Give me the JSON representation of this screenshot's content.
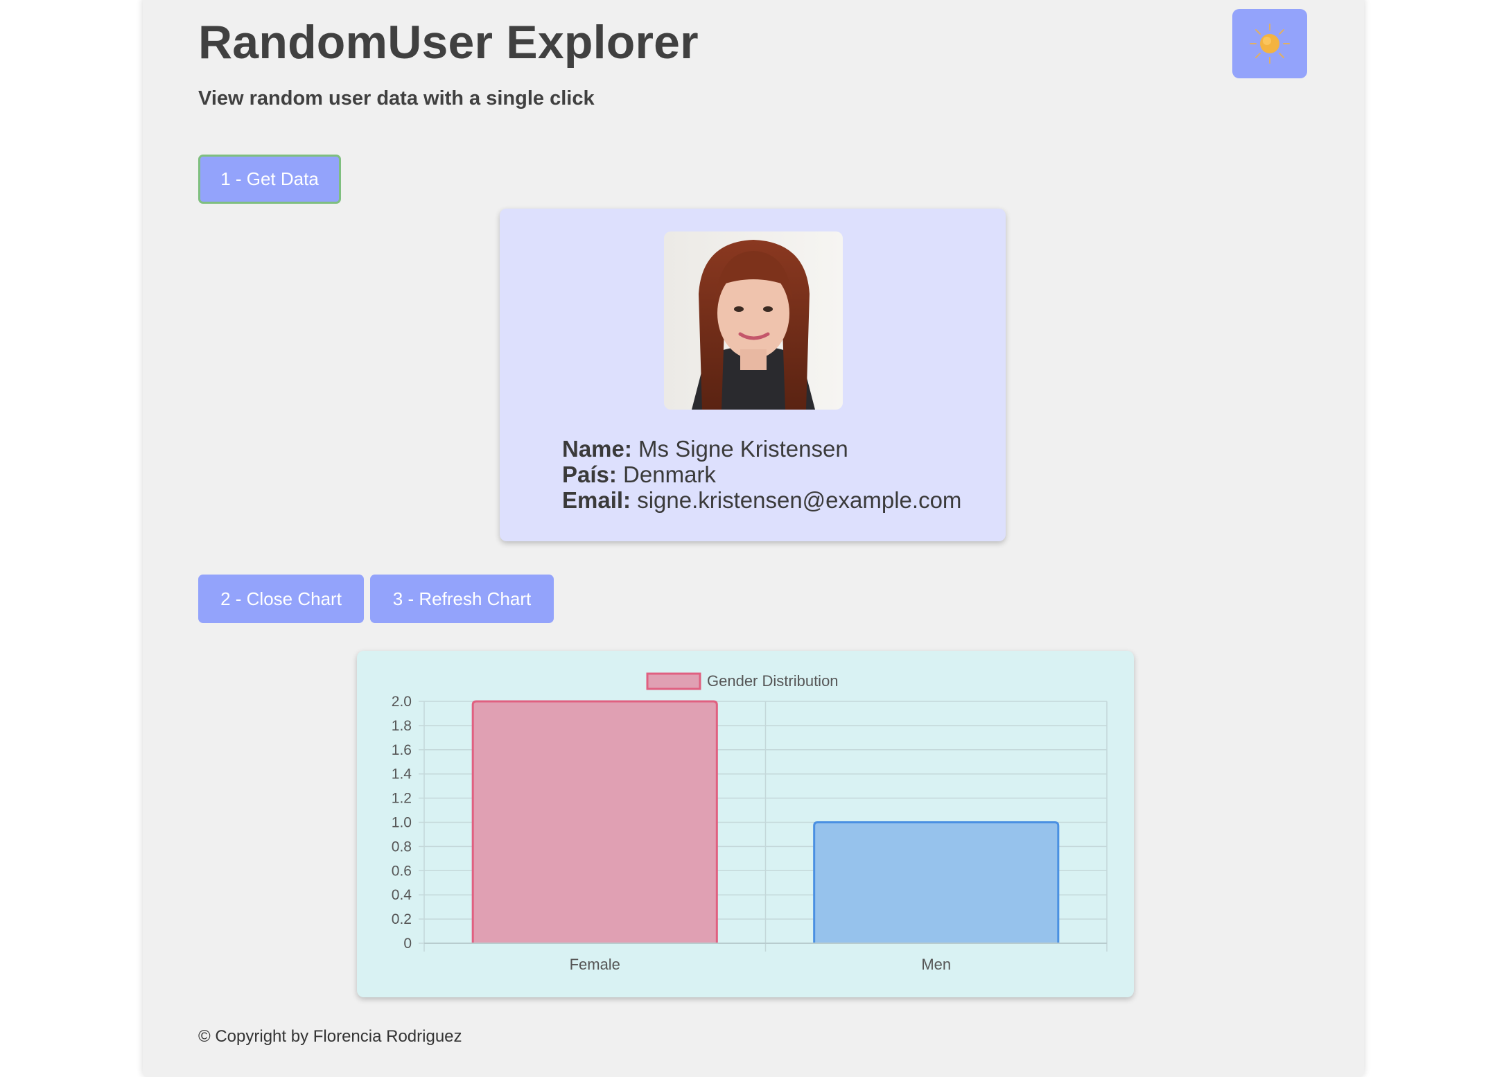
{
  "header": {
    "title": "RandomUser Explorer",
    "subtitle": "View random user data with a single click",
    "theme_icon": "sun-icon"
  },
  "actions": {
    "get_data": "1 - Get Data",
    "close_chart": "2 - Close Chart",
    "refresh_chart": "3 - Refresh Chart"
  },
  "user": {
    "photo_icon": "user-photo",
    "name_label": "Name:",
    "name": "Ms Signe Kristensen",
    "country_label": "País:",
    "country": "Denmark",
    "email_label": "Email:",
    "email": "signe.kristensen@example.com"
  },
  "colors": {
    "accent": "#93a3fb",
    "card_bg": "#dde0fd",
    "chart_bg": "#d9f2f3",
    "female": "#e0a0b3",
    "female_border": "#e06080",
    "men": "#96c2ec",
    "men_border": "#4a90e2"
  },
  "chart_data": {
    "type": "bar",
    "categories": [
      "Female",
      "Men"
    ],
    "series": [
      {
        "name": "Gender Distribution",
        "values": [
          2,
          1
        ]
      }
    ],
    "ylim": [
      0,
      2.0
    ],
    "yticks": [
      "2.0",
      "1.8",
      "1.6",
      "1.4",
      "1.2",
      "1.0",
      "0.8",
      "0.6",
      "0.4",
      "0.2",
      "0"
    ],
    "grid": true,
    "legend": "top-center"
  },
  "footer": {
    "copyright": "© Copyright by Florencia Rodriguez"
  }
}
